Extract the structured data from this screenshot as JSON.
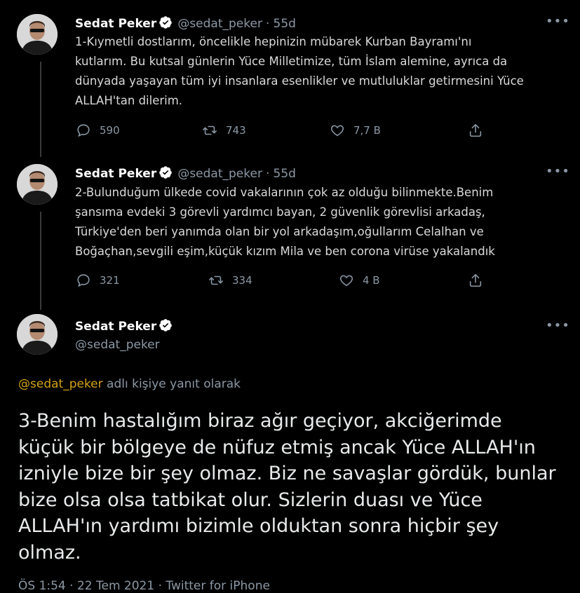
{
  "tweets": [
    {
      "author_name": "Sedat Peker",
      "author_handle": "@sedat_peker",
      "separator": "·",
      "time": "55d",
      "lines": [
        "1-Kıymetli dostlarım, öncelikle hepinizin mübarek Kurban Bayramı'nı",
        "kutlarım. Bu kutsal günlerin Yüce Milletimize, tüm İslam alemine, ayrıca da",
        "dünyada yaşayan tüm iyi insanlara esenlikler ve mutluluklar getirmesini Yüce",
        "ALLAH'tan dilerim."
      ],
      "replies": "590",
      "retweets": "743",
      "likes": "7,7 B",
      "more": "•••"
    },
    {
      "author_name": "Sedat Peker",
      "author_handle": "@sedat_peker",
      "separator": "·",
      "time": "55d",
      "lines": [
        "2-Bulunduğum ülkede covid vakalarının çok az olduğu bilinmekte.Benim",
        "şansıma evdeki 3 görevli yardımcı bayan, 2 güvenlik görevlisi arkadaş,",
        "Türkiye'den beri yanımda olan bir yol arkadaşım,oğullarım Celalhan ve",
        "Boğaçhan,sevgili eşim,küçük kızım Mila ve ben corona virüse yakalandık"
      ],
      "replies": "321",
      "retweets": "334",
      "likes": "4 B",
      "more": "•••"
    }
  ],
  "main_tweet": {
    "author_name": "Sedat Peker",
    "author_handle": "@sedat_peker",
    "more": "•••",
    "reply_mention": "@sedat_peker",
    "reply_suffix": " adlı kişiye yanıt olarak",
    "lines": [
      "3-Benim hastalığım biraz ağır geçiyor, akciğerimde",
      "küçük bir bölgeye de nüfuz etmiş ancak Yüce ALLAH'ın",
      "izniyle bize bir şey olmaz. Biz ne savaşlar gördük, bunlar",
      "bize olsa olsa tatbikat olur. Sizlerin duası ve Yüce",
      "ALLAH'ın yardımı bizimle olduktan sonra hiçbir şey",
      "olmaz."
    ],
    "footer": "ÖS 1:54 · 22 Tem 2021 · Twitter for iPhone"
  },
  "colors": {
    "background": "#000000",
    "text": "#d9d9d9",
    "muted": "#8b98a5",
    "verified": "#ffffff",
    "mention": "#d4a017"
  }
}
